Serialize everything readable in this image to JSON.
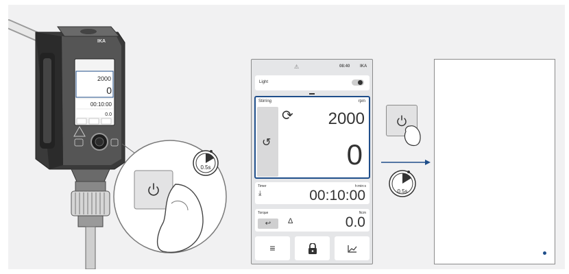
{
  "device": {
    "brand": "IKA",
    "mini_display": {
      "set_speed": "2000",
      "actual_speed": "0",
      "timer": "00:10:00",
      "torque": "0.0"
    },
    "press_indicator": "0.5s"
  },
  "phone": {
    "status": {
      "time": "08:40",
      "brand": "IKA"
    },
    "light": {
      "label": "Light",
      "state": "on"
    },
    "stirring": {
      "title": "Stirring",
      "unit": "rpm",
      "set_value": "2000",
      "actual_value": "0"
    },
    "timer": {
      "title": "Timer",
      "unit": "h:min:s",
      "value": "00:10:00"
    },
    "torque": {
      "title": "Torque",
      "unit": "Ncm",
      "value": "0.0"
    },
    "nav": {
      "menu_icon": "menu-icon",
      "lock_icon": "lock-icon",
      "chart_icon": "chart-icon"
    }
  },
  "power_step": {
    "hold_label": "0.5s"
  },
  "colors": {
    "accent": "#1f4e8a",
    "panel_bg": "#f1f1f2"
  }
}
